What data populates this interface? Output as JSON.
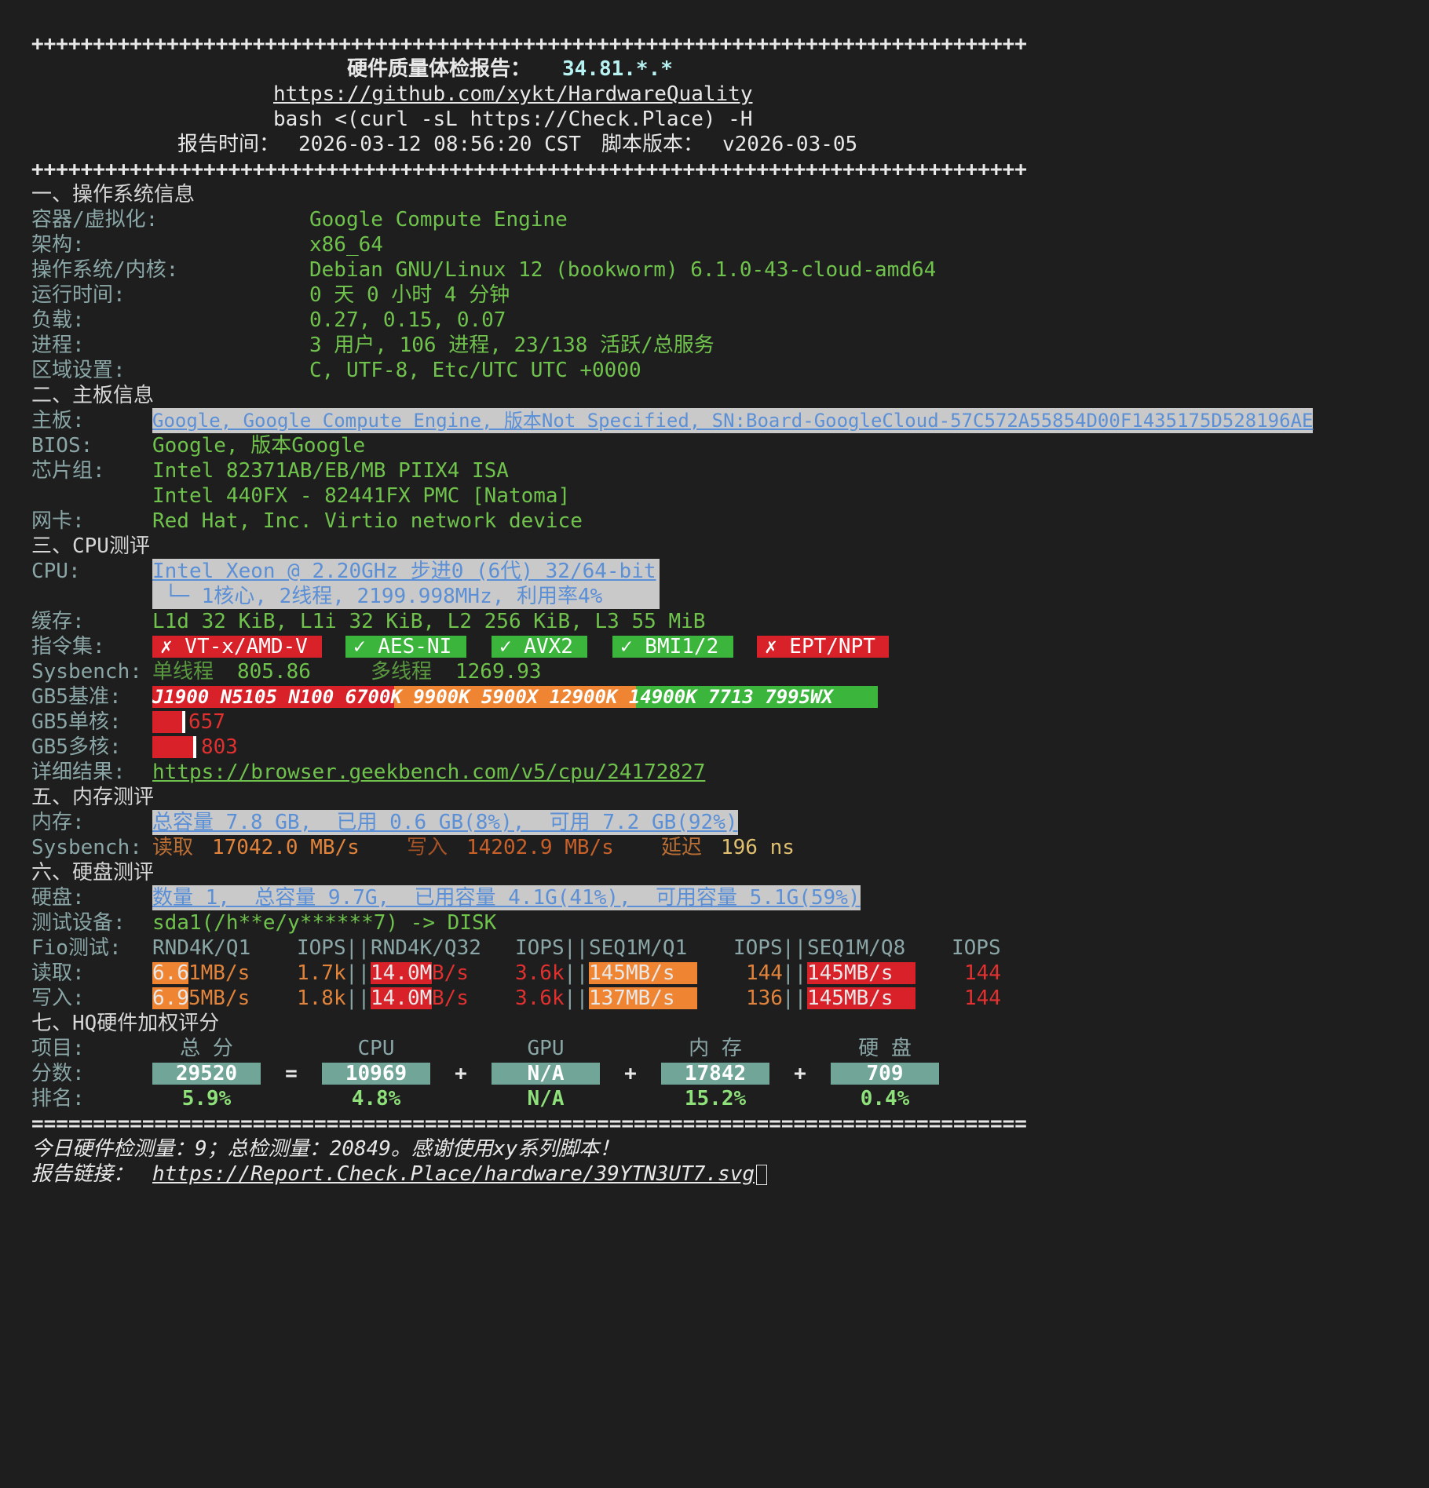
{
  "header": {
    "border": "+++++++++++++++++++++++++++++++++++++++++++++++++++++++++++++++++++++++++++++++++",
    "title_prefix": "硬件质量体检报告：",
    "title_ip": "34.81.*.*",
    "repo_url": "https://github.com/xykt/HardwareQuality",
    "command": "bash <(curl -sL https://Check.Place) -H",
    "report_time_label": "报告时间：",
    "report_time": "2026-03-12 08:56:20 CST",
    "script_version_label": "脚本版本：",
    "script_version": "v2026-03-05"
  },
  "os": {
    "heading": "一、操作系统信息",
    "rows": [
      {
        "label": "容器/虚拟化:",
        "value": "Google Compute Engine"
      },
      {
        "label": "架构:",
        "value": "x86_64"
      },
      {
        "label": "操作系统/内核:",
        "value": "Debian GNU/Linux 12 (bookworm) 6.1.0-43-cloud-amd64"
      },
      {
        "label": "运行时间:",
        "value": "0 天 0 小时 4 分钟"
      },
      {
        "label": "负载:",
        "value": "0.27, 0.15, 0.07"
      },
      {
        "label": "进程:",
        "value": "3 用户, 106 进程, 23/138 活跃/总服务"
      },
      {
        "label": "区域设置:",
        "value": "C, UTF-8, Etc/UTC UTC +0000"
      }
    ]
  },
  "board": {
    "heading": "二、主板信息",
    "board_label": "主板:",
    "board_value": "Google, Google Compute Engine, 版本Not Specified, SN:Board-GoogleCloud-57C572A55854D00F1435175D528196AE",
    "bios_label": "BIOS:",
    "bios_value": "Google, 版本Google",
    "chipset_label": "芯片组:",
    "chipset_value_1": "Intel 82371AB/EB/MB PIIX4 ISA",
    "chipset_value_2": "Intel 440FX - 82441FX PMC [Natoma]",
    "nic_label": "网卡:",
    "nic_value": "Red Hat, Inc. Virtio network device"
  },
  "cpu": {
    "heading": "三、CPU测评",
    "cpu_label": "CPU:",
    "cpu_value_1": "Intel Xeon @ 2.20GHz 步进0 (6代) 32/64-bit",
    "cpu_value_2": " └─ 1核心, 2线程, 2199.998MHz, 利用率4%",
    "cache_label": "缓存:",
    "cache_value": "L1d 32 KiB, L1i 32 KiB, L2 256 KiB, L3 55 MiB",
    "isa_label": "指令集:",
    "isa": [
      {
        "text": "✗ VT-x/AMD-V",
        "status": "fail"
      },
      {
        "text": "✓ AES-NI",
        "status": "ok"
      },
      {
        "text": "✓ AVX2",
        "status": "ok"
      },
      {
        "text": "✓ BMI1/2",
        "status": "ok"
      },
      {
        "text": "✗ EPT/NPT",
        "status": "fail"
      }
    ],
    "sysbench_label": "Sysbench:",
    "single_label": "单线程",
    "single_value": "805.86",
    "multi_label": "多线程",
    "multi_value": "1269.93",
    "gb5_base_label": "GB5基准:",
    "gb5_base_text": "J1900 N5105 N100 6700K 9900K 5900X 12900K 14900K 7713 7995WX",
    "gb5_single_label": "GB5单核:",
    "gb5_single_value": "657",
    "gb5_multi_label": "GB5多核:",
    "gb5_multi_value": "803",
    "detail_label": "详细结果:",
    "detail_url": "https://browser.geekbench.com/v5/cpu/24172827"
  },
  "memory": {
    "heading": "五、内存测评",
    "mem_label": "内存:",
    "mem_value": "总容量 7.8 GB,  已用 0.6 GB(8%),  可用 7.2 GB(92%)",
    "sysbench_label": "Sysbench:",
    "read_label": "读取",
    "read_value": "17042.0 MB/s",
    "write_label": "写入",
    "write_value": "14202.9 MB/s",
    "latency_label": "延迟",
    "latency_value": "196 ns"
  },
  "disk": {
    "heading": "六、硬盘测评",
    "disk_label": "硬盘:",
    "disk_value": "数量 1,  总容量 9.7G,  已用容量 4.1G(41%),  可用容量 5.1G(59%)",
    "device_label": "测试设备:",
    "device_value": "sda1(/h**e/y******7) -> DISK",
    "fio_label": "Fio测试:",
    "columns": [
      {
        "name": "RND4K/Q1",
        "iops": "IOPS"
      },
      {
        "name": "RND4K/Q32",
        "iops": "IOPS"
      },
      {
        "name": "SEQ1M/Q1",
        "iops": "IOPS"
      },
      {
        "name": "SEQ1M/Q8",
        "iops": "IOPS"
      }
    ],
    "read_label": "读取:",
    "write_label": "写入:",
    "read": [
      {
        "bw_a": "6.6",
        "bw_b": "1MB/s",
        "iops": "1.7k"
      },
      {
        "bw_a": "14.0M",
        "bw_b": "B/s",
        "iops": "3.6k"
      },
      {
        "bw_a": "145MB/s",
        "bw_b": "",
        "iops": "144"
      },
      {
        "bw_a": "145MB/s",
        "bw_b": "",
        "iops": "144"
      }
    ],
    "write": [
      {
        "bw_a": "6.9",
        "bw_b": "5MB/s",
        "iops": "1.8k"
      },
      {
        "bw_a": "14.0M",
        "bw_b": "B/s",
        "iops": "3.6k"
      },
      {
        "bw_a": "137MB/s",
        "bw_b": "",
        "iops": "136"
      },
      {
        "bw_a": "145MB/s",
        "bw_b": "",
        "iops": "144"
      }
    ]
  },
  "score": {
    "heading": "七、HQ硬件加权评分",
    "item_label": "项目:",
    "score_label": "分数:",
    "rank_label": "排名:",
    "items": [
      "总 分",
      "CPU",
      "GPU",
      "内 存",
      "硬 盘"
    ],
    "scores": [
      "29520",
      "10969",
      "N/A",
      "17842",
      "709"
    ],
    "operators": [
      "=",
      "+",
      "+",
      "+"
    ],
    "ranks": [
      "5.9%",
      "4.8%",
      "N/A",
      "15.2%",
      "0.4%"
    ]
  },
  "footer": {
    "border": "=================================================================================",
    "stats": "今日硬件检测量：9；总检测量：20849。感谢使用xy系列脚本！",
    "report_label": "报告链接：",
    "report_url": "https://Report.Check.Place/hardware/39YTN3UT7.svg"
  },
  "colors": {
    "background": "#1e1e1e",
    "label": "#8aa6a6",
    "value": "#6fc24c",
    "fail": "#d9212a",
    "ok": "#3bb53c",
    "warn": "#ef8533",
    "score": "#70a597"
  }
}
